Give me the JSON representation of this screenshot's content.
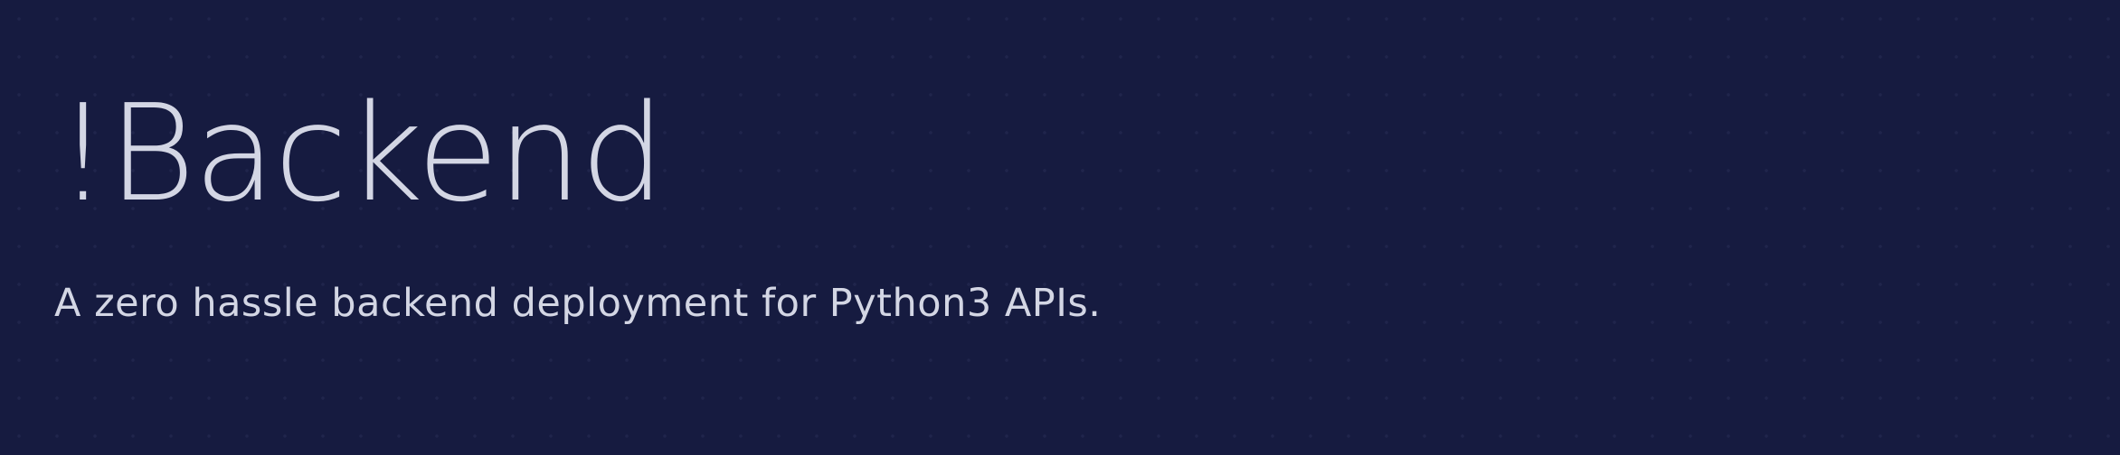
{
  "hero": {
    "title": "!Backend",
    "tagline": "A zero hassle backend deployment for Python3 APIs."
  },
  "colors": {
    "background": "#161b40",
    "text": "#d3d6e4",
    "dot_grid": "#2a3160"
  }
}
